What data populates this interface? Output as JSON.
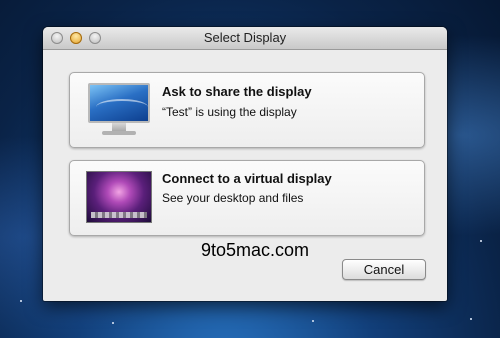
{
  "window": {
    "title": "Select Display"
  },
  "options": [
    {
      "title": "Ask to share the display",
      "subtitle": "“Test” is using the display"
    },
    {
      "title": "Connect to a virtual display",
      "subtitle": "See your desktop and files"
    }
  ],
  "cancel_label": "Cancel",
  "watermark": "9to5mac.com",
  "icons": {
    "option_1": "monitor-icon",
    "option_2": "virtual-desktop-thumbnail"
  },
  "colors": {
    "window_bg": "#ececec",
    "desktop_bg": "#123f7a"
  }
}
